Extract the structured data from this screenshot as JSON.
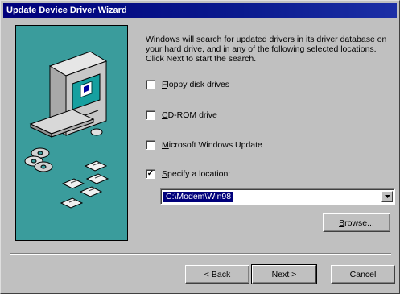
{
  "window": {
    "title": "Update Device Driver Wizard"
  },
  "intro_text": "Windows will search for updated drivers in its driver database on your hard drive, and in any of the following selected locations. Click Next to start the search.",
  "options": [
    {
      "label": "Floppy disk drives",
      "checked": false,
      "check_glyph": ""
    },
    {
      "label": "CD-ROM drive",
      "checked": false,
      "check_glyph": ""
    },
    {
      "label": "Microsoft Windows Update",
      "checked": false,
      "check_glyph": ""
    },
    {
      "label": "Specify a location:",
      "checked": true,
      "check_glyph": "✓"
    }
  ],
  "location": {
    "value": "C:\\Modem\\Win98"
  },
  "buttons": {
    "browse": "Browse...",
    "back": "< Back",
    "next": "Next >",
    "cancel": "Cancel"
  },
  "colors": {
    "titlebar": "#00007b",
    "art_background": "#3a9c9c",
    "dialog": "#c0c0c0"
  },
  "icons": [
    "computer-icon",
    "cd-disc-icon",
    "floppy-disk-icon",
    "dropdown-arrow-icon"
  ]
}
